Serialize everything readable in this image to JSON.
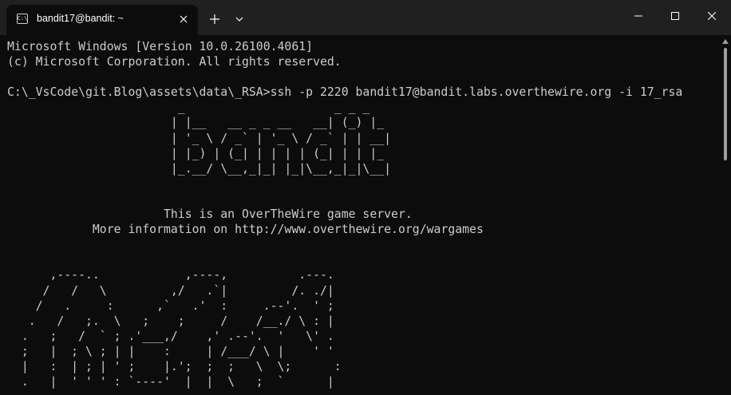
{
  "window": {
    "tab_title": "bandit17@bandit: ~",
    "tab_icon_glyph": "C:\\",
    "new_tab_label": "+",
    "minimize_icon": "minimize-icon",
    "maximize_icon": "maximize-icon",
    "close_icon": "close-icon"
  },
  "terminal": {
    "lines": [
      "Microsoft Windows [Version 10.0.26100.4061]",
      "(c) Microsoft Corporation. All rights reserved.",
      "",
      "C:\\_VsCode\\git.Blog\\assets\\data\\_RSA>ssh -p 2220 bandit17@bandit.labs.overthewire.org -i 17_rsa",
      "                        _                     _ _ _",
      "                       | |__   __ _ _ __   __| (_) |_",
      "                       | '_ \\ / _` | '_ \\ / _` | | __|",
      "                       | |_) | (_| | | | | (_| | | |_",
      "                       |_.__/ \\__,_|_| |_|\\__,_|_|\\__|",
      "",
      "",
      "                      This is an OverTheWire game server.",
      "            More information on http://www.overthewire.org/wargames",
      "",
      "",
      "      ,----..            ,----,          .---.",
      "     /   /   \\         ,/   .`|         /. ./|",
      "    /   .     :      ,`   .'  :     .--'.  ' ;",
      "   .   /   ;.  \\   ;    ;     /    /__./ \\ : |",
      "  .   ;   /  ` ; .'___,/    ,' .--'.  '   \\' .",
      "  ;   |  ; \\ ; | |    :     | /___/ \\ |    ' '",
      "  |   :  | ; | ' ;    |.';  ;  ;   \\  \\;      :",
      "  .   |  ' ' ' : `----'  |  |  \\   ;  `      |"
    ]
  }
}
